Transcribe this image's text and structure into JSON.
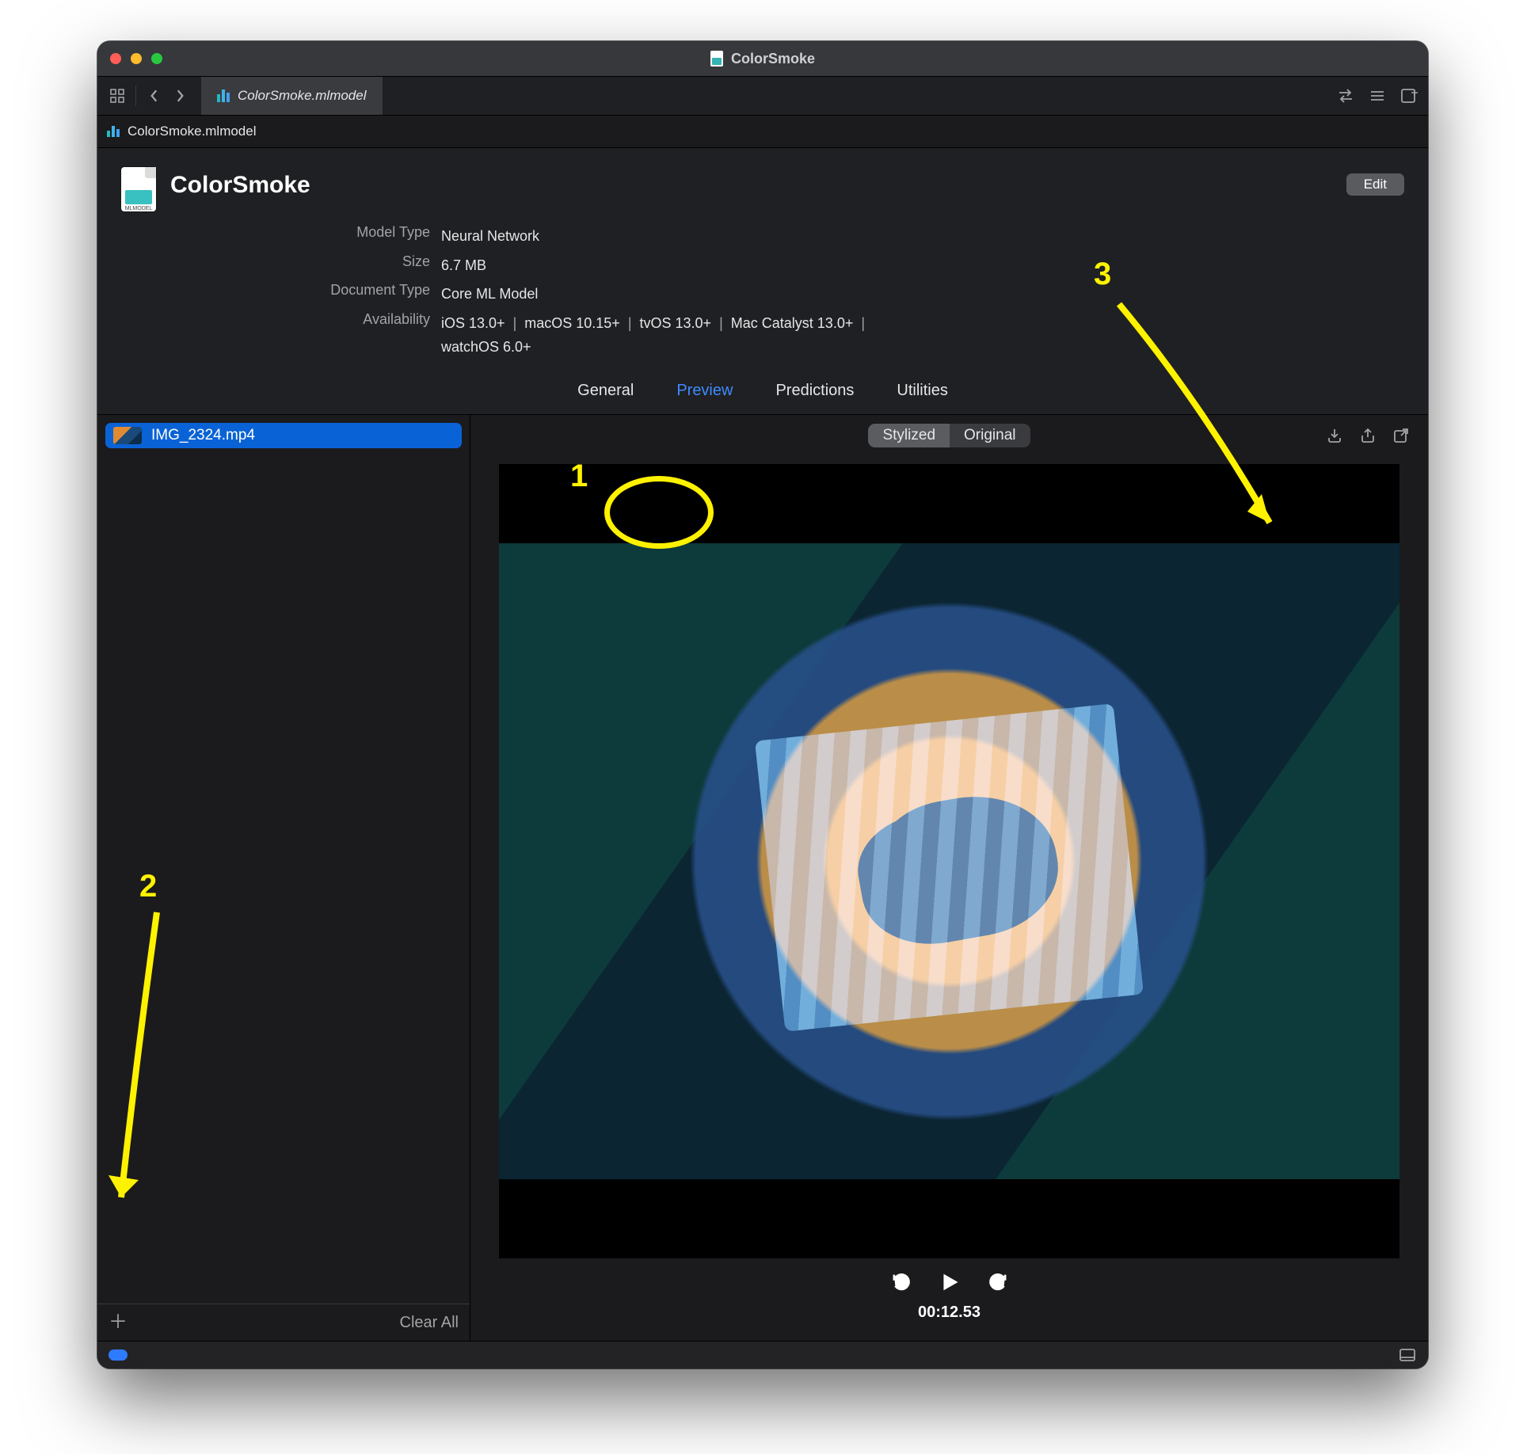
{
  "window": {
    "title": "ColorSmoke"
  },
  "toolbar": {
    "tab_label": "ColorSmoke.mlmodel"
  },
  "breadcrumb": {
    "file": "ColorSmoke.mlmodel"
  },
  "model": {
    "name": "ColorSmoke",
    "edit_label": "Edit",
    "info": {
      "model_type_label": "Model Type",
      "model_type_value": "Neural Network",
      "size_label": "Size",
      "size_value": "6.7 MB",
      "doc_type_label": "Document Type",
      "doc_type_value": "Core ML Model",
      "availability_label": "Availability",
      "availability_values": [
        "iOS 13.0+",
        "macOS 10.15+",
        "tvOS 13.0+",
        "Mac Catalyst 13.0+",
        "watchOS 6.0+"
      ]
    }
  },
  "pane_tabs": {
    "general": "General",
    "preview": "Preview",
    "predictions": "Predictions",
    "utilities": "Utilities",
    "active": "preview"
  },
  "sidebar": {
    "items": [
      {
        "label": "IMG_2324.mp4"
      }
    ],
    "clear_all": "Clear All"
  },
  "preview": {
    "segmented": {
      "stylized": "Stylized",
      "original": "Original",
      "selected": "stylized"
    },
    "timecode": "00:12.53"
  },
  "annotations": {
    "a1": "1",
    "a2": "2",
    "a3": "3"
  },
  "icons": {
    "grid": "grid-icon",
    "back": "chevron-left-icon",
    "forward": "chevron-right-icon",
    "swap": "swap-icon",
    "lines": "lines-icon",
    "add_panel": "add-panel-icon",
    "download": "download-icon",
    "share": "share-icon",
    "open_ext": "open-external-icon",
    "rewind": "rewind-icon",
    "play": "play-icon",
    "loop": "loop-icon",
    "sidebar_footer": "sidebar-toggle-icon"
  }
}
